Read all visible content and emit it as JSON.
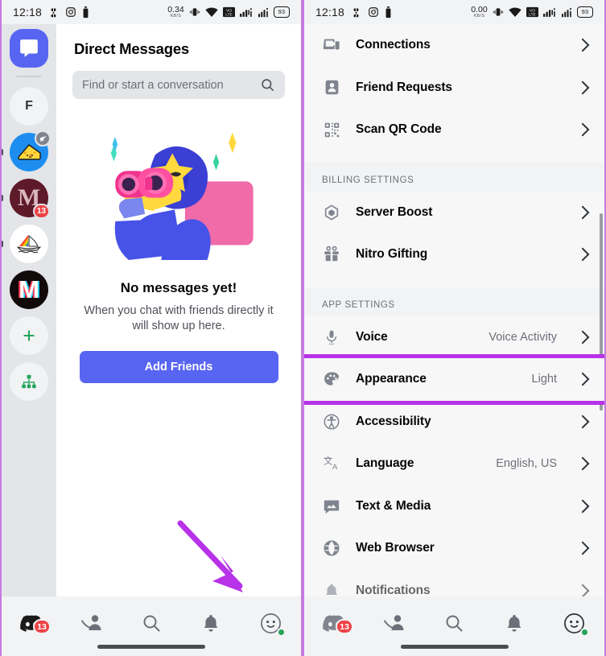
{
  "left_phone": {
    "status_bar": {
      "time": "12:18",
      "net_rate_value": "0.34",
      "net_rate_unit": "KB/S",
      "battery": "93",
      "icons": [
        "pinwheel-icon",
        "instagram-icon",
        "battery-saver-icon",
        "vibrate-icon",
        "wifi-icon",
        "vowifi-icon",
        "signal-bars-icon",
        "signal-bars-2-icon",
        "battery-icon"
      ]
    },
    "guild_rail": {
      "home_label": "Direct Messages",
      "items": [
        {
          "name": "home",
          "icon": "chat-bubble-icon",
          "label": "",
          "badge": "",
          "active": true
        },
        {
          "name": "server-f",
          "icon": "letter-avatar",
          "label": "F",
          "badge": ""
        },
        {
          "name": "server-cheese",
          "icon": "cheese-avatar",
          "label": "",
          "badge": "",
          "muted": true
        },
        {
          "name": "server-m-maroon",
          "icon": "letter-avatar",
          "label": "M",
          "badge": "13"
        },
        {
          "name": "server-sailboat",
          "icon": "sailboat-avatar",
          "label": "",
          "badge": ""
        },
        {
          "name": "server-m-black",
          "icon": "letter-avatar",
          "label": "M",
          "badge": ""
        },
        {
          "name": "add-server",
          "icon": "plus-icon",
          "label": "",
          "badge": ""
        },
        {
          "name": "explore-servers",
          "icon": "compass-tree-icon",
          "label": "",
          "badge": ""
        }
      ]
    },
    "dm": {
      "title": "Direct Messages",
      "search_placeholder": "Find or start a conversation",
      "search_value": "",
      "search_icon": "search-icon",
      "empty_title": "No messages yet!",
      "empty_subtitle": "When you chat with friends directly it will show up here.",
      "cta_label": "Add Friends"
    },
    "bottom_nav": [
      {
        "name": "tab-servers",
        "icon": "discord-logo-icon",
        "badge": "13"
      },
      {
        "name": "tab-friends",
        "icon": "friends-icon",
        "badge": ""
      },
      {
        "name": "tab-search",
        "icon": "search-icon",
        "badge": ""
      },
      {
        "name": "tab-notifications",
        "icon": "bell-icon",
        "badge": ""
      },
      {
        "name": "tab-profile",
        "icon": "profile-avatar-icon",
        "badge": "",
        "status": "online"
      }
    ],
    "annotation": {
      "type": "arrow",
      "color": "#b732e8",
      "points_to": "tab-profile"
    }
  },
  "right_phone": {
    "status_bar": {
      "time": "12:18",
      "net_rate_value": "0.00",
      "net_rate_unit": "KB/S",
      "battery": "93"
    },
    "settings": {
      "top_items": [
        {
          "name": "connections",
          "label": "Connections",
          "icon": "devices-icon",
          "value": ""
        },
        {
          "name": "friend-requests",
          "label": "Friend Requests",
          "icon": "person-card-icon",
          "value": ""
        },
        {
          "name": "scan-qr-code",
          "label": "Scan QR Code",
          "icon": "qr-code-icon",
          "value": ""
        }
      ],
      "billing_header": "BILLING SETTINGS",
      "billing_items": [
        {
          "name": "server-boost",
          "label": "Server Boost",
          "icon": "boost-gem-icon",
          "value": ""
        },
        {
          "name": "nitro-gifting",
          "label": "Nitro Gifting",
          "icon": "gift-icon",
          "value": ""
        }
      ],
      "app_header": "APP SETTINGS",
      "app_items": [
        {
          "name": "voice",
          "label": "Voice",
          "icon": "microphone-icon",
          "value": "Voice Activity",
          "highlighted": false
        },
        {
          "name": "appearance",
          "label": "Appearance",
          "icon": "palette-icon",
          "value": "Light",
          "highlighted": true
        },
        {
          "name": "accessibility",
          "label": "Accessibility",
          "icon": "accessibility-icon",
          "value": "",
          "highlighted": false
        },
        {
          "name": "language",
          "label": "Language",
          "icon": "translate-icon",
          "value": "English, US",
          "highlighted": false
        },
        {
          "name": "text-and-media",
          "label": "Text & Media",
          "icon": "image-icon",
          "value": "",
          "highlighted": false
        },
        {
          "name": "web-browser",
          "label": "Web Browser",
          "icon": "globe-icon",
          "value": "",
          "highlighted": false
        },
        {
          "name": "notifications",
          "label": "Notifications",
          "icon": "bell-icon",
          "value": "",
          "highlighted": false,
          "clipped": true
        }
      ],
      "highlight_color": "#b732e8"
    },
    "bottom_nav": [
      {
        "name": "tab-servers",
        "icon": "discord-logo-icon",
        "badge": "13"
      },
      {
        "name": "tab-friends",
        "icon": "friends-icon",
        "badge": ""
      },
      {
        "name": "tab-search",
        "icon": "search-icon",
        "badge": ""
      },
      {
        "name": "tab-notifications",
        "icon": "bell-icon",
        "badge": ""
      },
      {
        "name": "tab-profile",
        "icon": "profile-avatar-icon",
        "badge": "",
        "status": "online"
      }
    ]
  }
}
